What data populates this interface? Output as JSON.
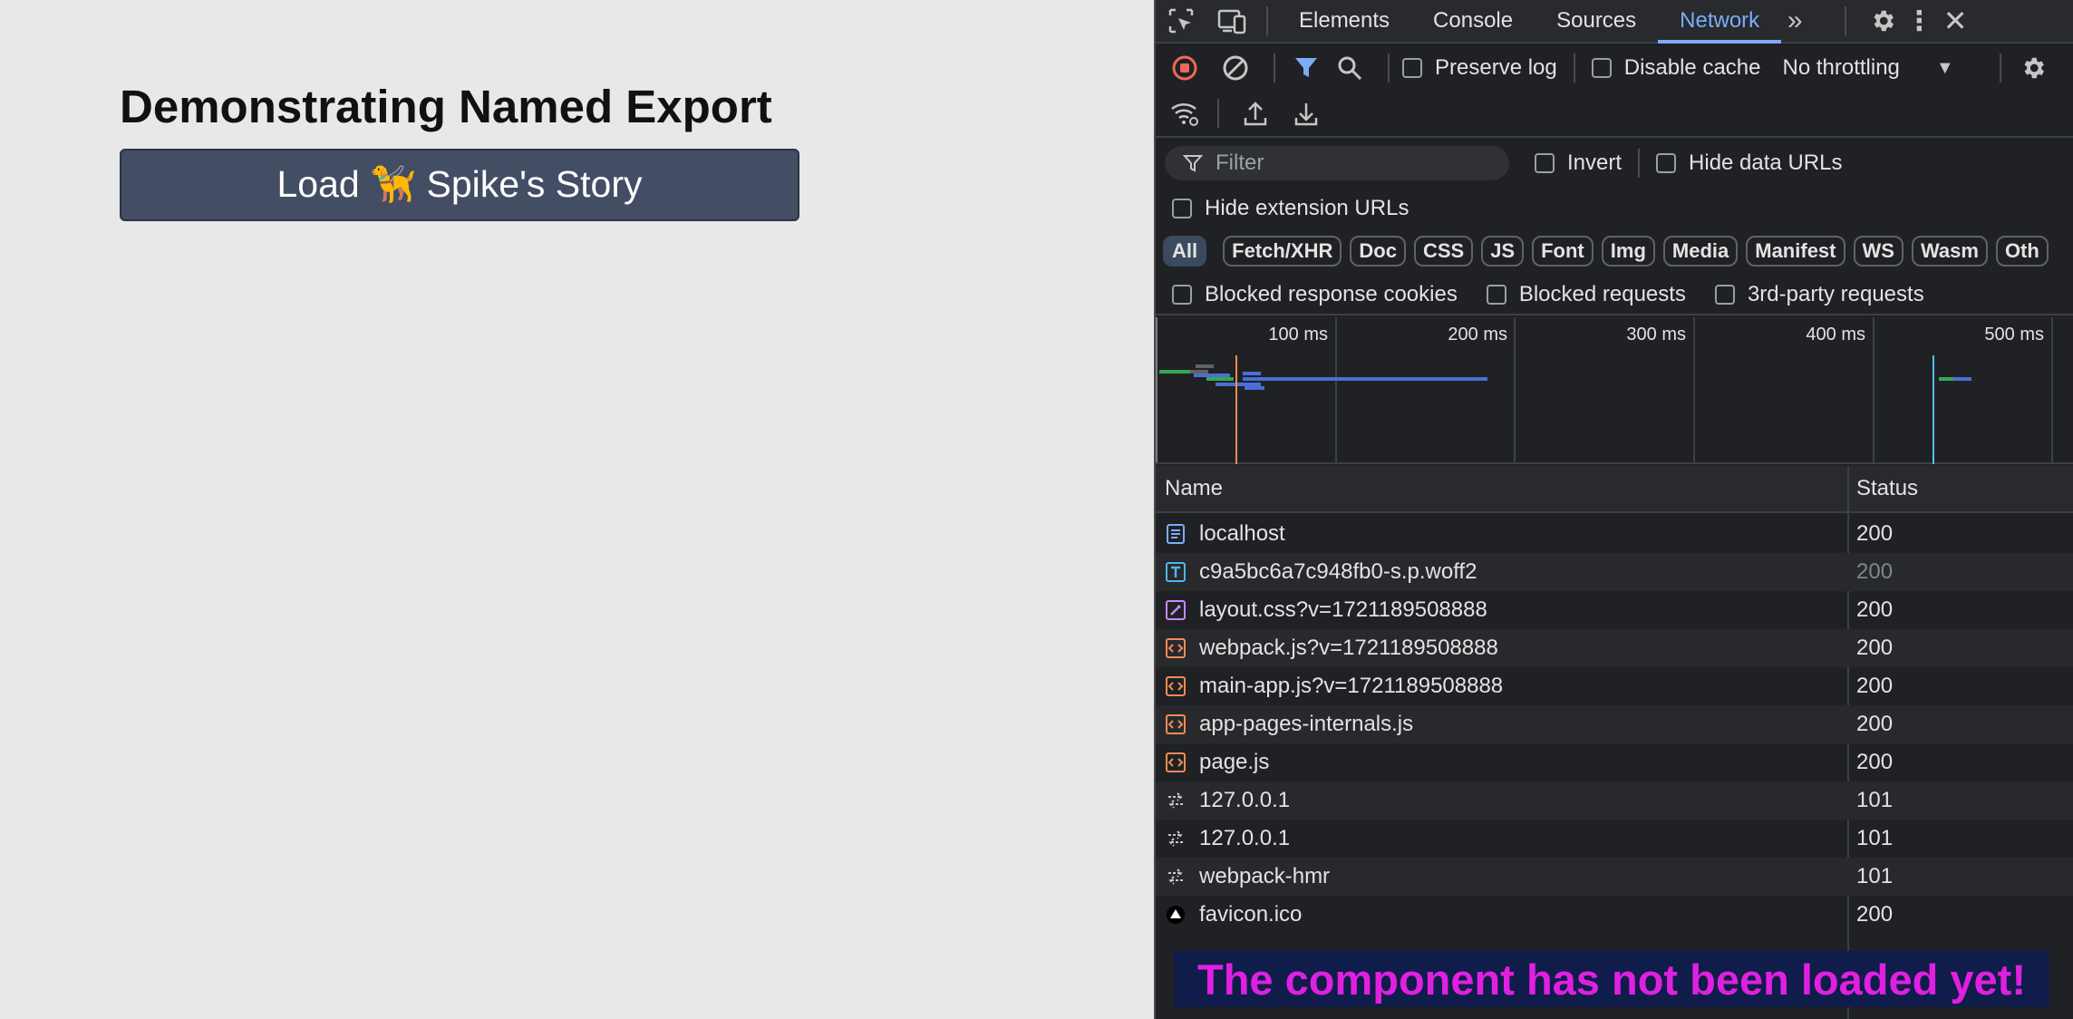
{
  "page": {
    "heading_prefix": "Demonstrating ",
    "heading_bold": "Named Export",
    "button_label": "Load 🦮 Spike's Story"
  },
  "devtools": {
    "tabs": [
      "Elements",
      "Console",
      "Sources",
      "Network"
    ],
    "active_tab": "Network",
    "toolbar": {
      "preserve_log": "Preserve log",
      "disable_cache": "Disable cache",
      "throttling": "No throttling"
    },
    "filter": {
      "placeholder": "Filter",
      "invert": "Invert",
      "hide_data_urls": "Hide data URLs",
      "hide_extension_urls": "Hide extension URLs"
    },
    "type_filters": [
      "All",
      "Fetch/XHR",
      "Doc",
      "CSS",
      "JS",
      "Font",
      "Img",
      "Media",
      "Manifest",
      "WS",
      "Wasm",
      "Oth"
    ],
    "blocked": {
      "cookies": "Blocked response cookies",
      "requests": "Blocked requests",
      "third_party": "3rd-party requests"
    },
    "timeline_labels": [
      "100 ms",
      "200 ms",
      "300 ms",
      "400 ms",
      "500 ms"
    ],
    "columns": {
      "name": "Name",
      "status": "Status"
    },
    "requests": [
      {
        "name": "localhost",
        "status": "200",
        "type": "doc"
      },
      {
        "name": "c9a5bc6a7c948fb0-s.p.woff2",
        "status": "200",
        "type": "font"
      },
      {
        "name": "layout.css?v=1721189508888",
        "status": "200",
        "type": "css"
      },
      {
        "name": "webpack.js?v=1721189508888",
        "status": "200",
        "type": "js"
      },
      {
        "name": "main-app.js?v=1721189508888",
        "status": "200",
        "type": "js"
      },
      {
        "name": "app-pages-internals.js",
        "status": "200",
        "type": "js"
      },
      {
        "name": "page.js",
        "status": "200",
        "type": "js"
      },
      {
        "name": "127.0.0.1",
        "status": "101",
        "type": "ws"
      },
      {
        "name": "127.0.0.1",
        "status": "101",
        "type": "ws"
      },
      {
        "name": "webpack-hmr",
        "status": "101",
        "type": "ws"
      },
      {
        "name": "favicon.ico",
        "status": "200",
        "type": "ico"
      }
    ],
    "colors": {
      "doc": "#7cacf8",
      "font": "#4fb5e8",
      "css": "#c58af9",
      "js": "#f28b54",
      "ws": "#c4c7c5",
      "ico": "#ffffff",
      "accent": "#7cacf8",
      "banner_text": "#e020e0"
    }
  },
  "banner": "The component has not been loaded yet!"
}
